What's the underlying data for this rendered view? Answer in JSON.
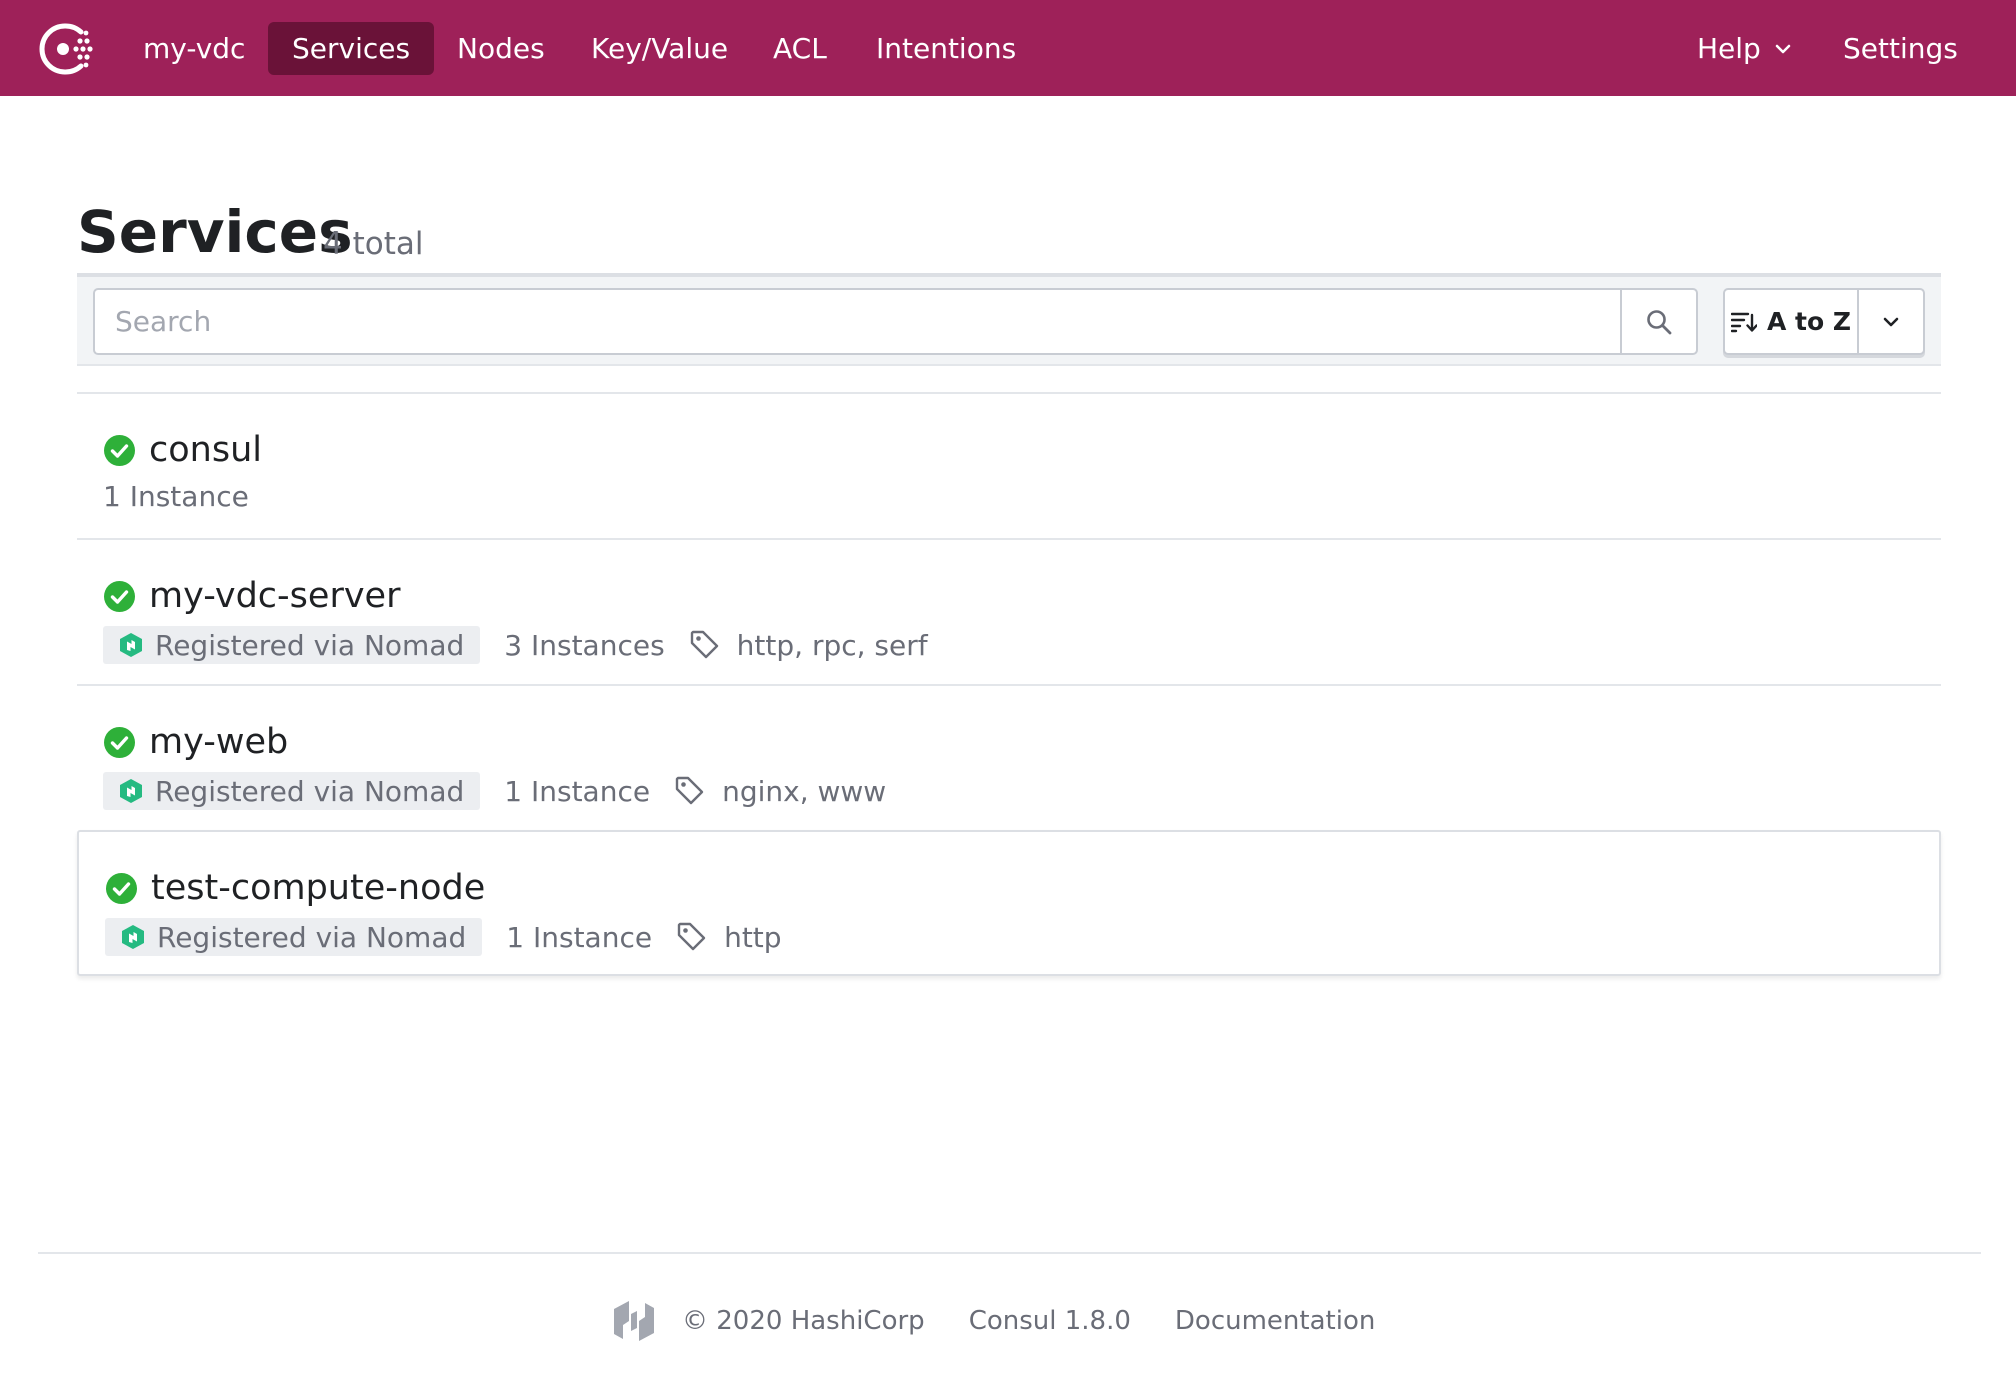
{
  "nav": {
    "datacenter": "my-vdc",
    "items": [
      {
        "label": "Services",
        "active": true
      },
      {
        "label": "Nodes",
        "active": false
      },
      {
        "label": "Key/Value",
        "active": false
      },
      {
        "label": "ACL",
        "active": false
      },
      {
        "label": "Intentions",
        "active": false
      }
    ],
    "help": "Help",
    "settings": "Settings"
  },
  "header": {
    "title": "Services",
    "count": "4 total"
  },
  "search": {
    "placeholder": "Search",
    "value": ""
  },
  "sort": {
    "label": "A to Z"
  },
  "services": [
    {
      "name": "consul",
      "status": "passing",
      "source": "",
      "instances": "1 Instance",
      "tags": ""
    },
    {
      "name": "my-vdc-server",
      "status": "passing",
      "source": "Registered via Nomad",
      "instances": "3 Instances",
      "tags": "http, rpc, serf"
    },
    {
      "name": "my-web",
      "status": "passing",
      "source": "Registered via Nomad",
      "instances": "1 Instance",
      "tags": "nginx, www"
    },
    {
      "name": "test-compute-node",
      "status": "passing",
      "source": "Registered via Nomad",
      "instances": "1 Instance",
      "tags": "http"
    }
  ],
  "footer": {
    "copyright": "© 2020 HashiCorp",
    "version": "Consul 1.8.0",
    "docs": "Documentation"
  },
  "colors": {
    "brand": "#9e2159",
    "nav_active": "#6a1238",
    "passing": "#2eb039",
    "nomad": "#25ba81"
  }
}
